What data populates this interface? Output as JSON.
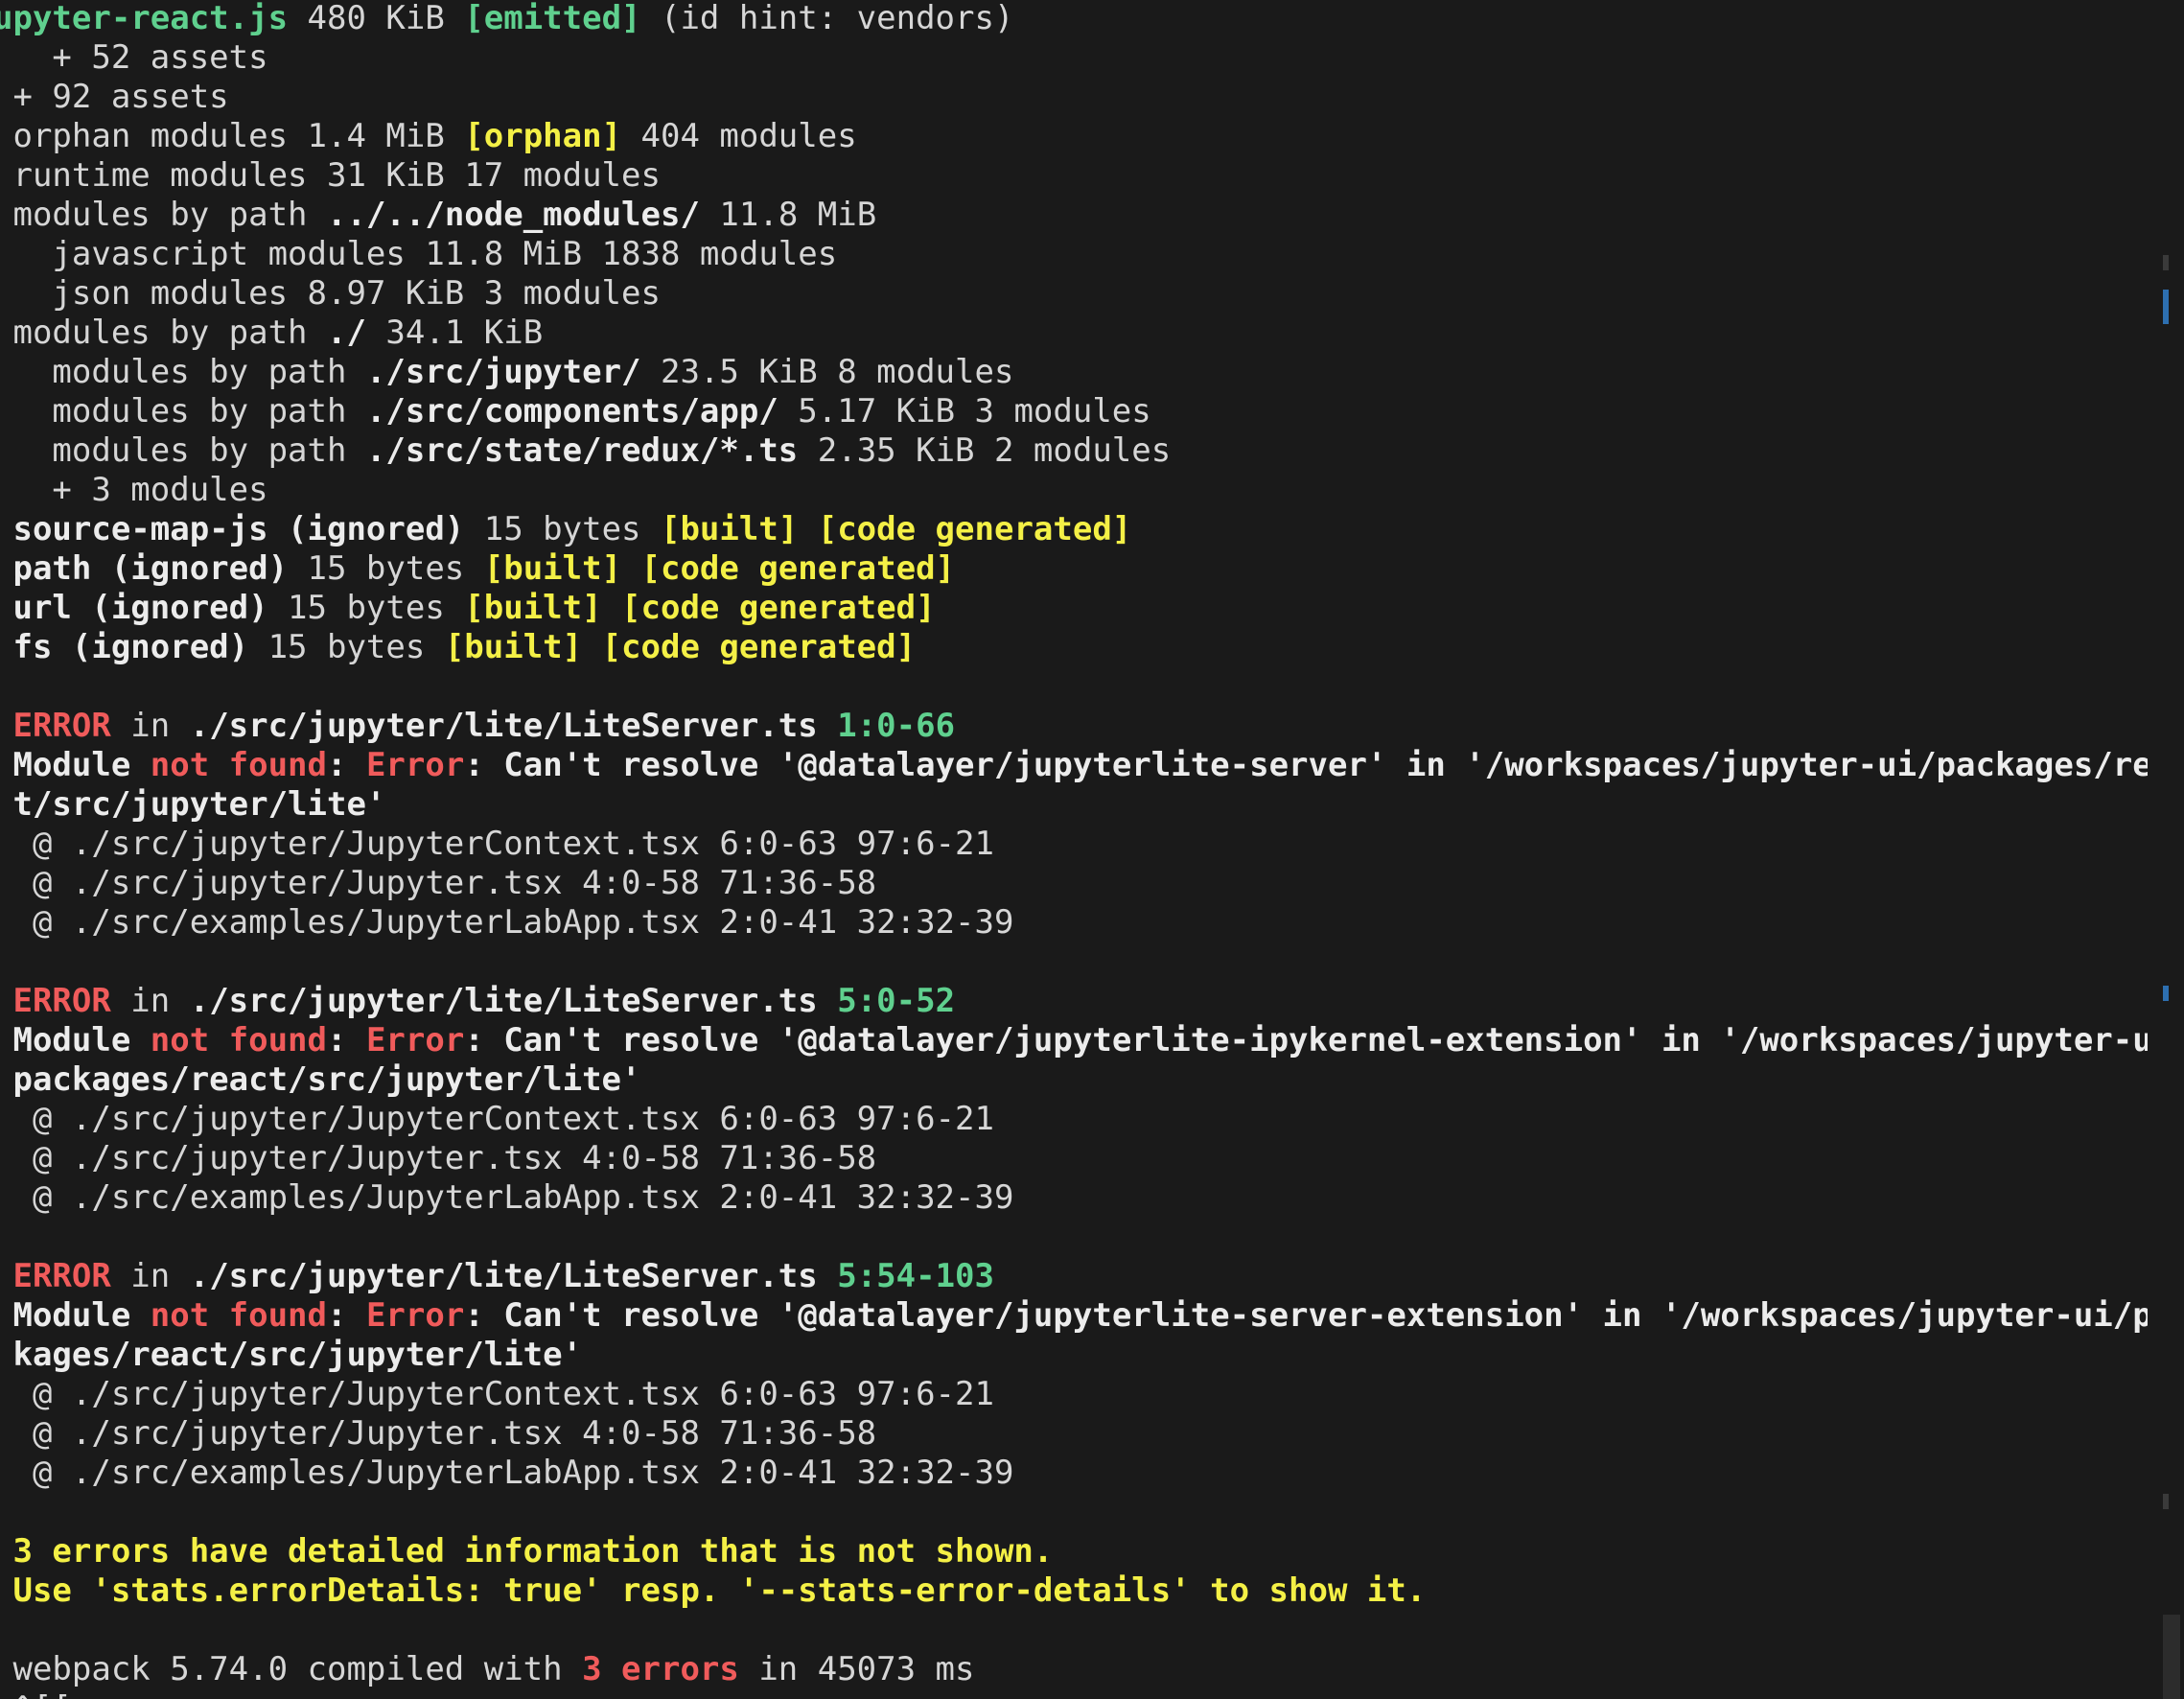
{
  "terminal": {
    "lines": [
      [
        {
          "t": "upyter-react.js ",
          "c": "bgreen"
        },
        {
          "t": "480 KiB ",
          "c": "white"
        },
        {
          "t": "[emitted]",
          "c": "bgreen"
        },
        {
          "t": " (id hint: vendors)",
          "c": "white"
        }
      ],
      [
        {
          "t": "   + 52 assets",
          "c": "white"
        }
      ],
      [
        {
          "t": " + 92 assets",
          "c": "white"
        }
      ],
      [
        {
          "t": " orphan modules 1.4 MiB ",
          "c": "white"
        },
        {
          "t": "[orphan]",
          "c": "yellow"
        },
        {
          "t": " 404 modules",
          "c": "white"
        }
      ],
      [
        {
          "t": " runtime modules 31 KiB 17 modules",
          "c": "white"
        }
      ],
      [
        {
          "t": " modules by path ",
          "c": "white"
        },
        {
          "t": "../../node_modules/",
          "c": "bwhite"
        },
        {
          "t": " 11.8 MiB",
          "c": "white"
        }
      ],
      [
        {
          "t": "   javascript modules 11.8 MiB 1838 modules",
          "c": "white"
        }
      ],
      [
        {
          "t": "   json modules 8.97 KiB 3 modules",
          "c": "white"
        }
      ],
      [
        {
          "t": " modules by path ",
          "c": "white"
        },
        {
          "t": "./",
          "c": "bwhite"
        },
        {
          "t": " 34.1 KiB",
          "c": "white"
        }
      ],
      [
        {
          "t": "   modules by path ",
          "c": "white"
        },
        {
          "t": "./src/jupyter/",
          "c": "bwhite"
        },
        {
          "t": " 23.5 KiB 8 modules",
          "c": "white"
        }
      ],
      [
        {
          "t": "   modules by path ",
          "c": "white"
        },
        {
          "t": "./src/components/app/",
          "c": "bwhite"
        },
        {
          "t": " 5.17 KiB 3 modules",
          "c": "white"
        }
      ],
      [
        {
          "t": "   modules by path ",
          "c": "white"
        },
        {
          "t": "./src/state/redux/*.ts",
          "c": "bwhite"
        },
        {
          "t": " 2.35 KiB 2 modules",
          "c": "white"
        }
      ],
      [
        {
          "t": "   + 3 modules",
          "c": "white"
        }
      ],
      [
        {
          "t": " source-map-js (ignored)",
          "c": "bwhite"
        },
        {
          "t": " 15 bytes ",
          "c": "white"
        },
        {
          "t": "[built] [code generated]",
          "c": "yellow"
        }
      ],
      [
        {
          "t": " path (ignored)",
          "c": "bwhite"
        },
        {
          "t": " 15 bytes ",
          "c": "white"
        },
        {
          "t": "[built] [code generated]",
          "c": "yellow"
        }
      ],
      [
        {
          "t": " url (ignored)",
          "c": "bwhite"
        },
        {
          "t": " 15 bytes ",
          "c": "white"
        },
        {
          "t": "[built] [code generated]",
          "c": "yellow"
        }
      ],
      [
        {
          "t": " fs (ignored)",
          "c": "bwhite"
        },
        {
          "t": " 15 bytes ",
          "c": "white"
        },
        {
          "t": "[built] [code generated]",
          "c": "yellow"
        }
      ],
      [],
      [
        {
          "t": " ERROR",
          "c": "bred"
        },
        {
          "t": " in ",
          "c": "white"
        },
        {
          "t": "./src/jupyter/lite/LiteServer.ts",
          "c": "bwhite"
        },
        {
          "t": " 1:0-66",
          "c": "bgreen"
        }
      ],
      [
        {
          "t": " Module ",
          "c": "bwhite"
        },
        {
          "t": "not found",
          "c": "bred"
        },
        {
          "t": ": ",
          "c": "bwhite"
        },
        {
          "t": "Error",
          "c": "bred"
        },
        {
          "t": ": Can't resolve '@datalayer/jupyterlite-server' in '/workspaces/jupyter-ui/packages/reac",
          "c": "bwhite"
        }
      ],
      [
        {
          "t": " t/src/jupyter/lite'",
          "c": "bwhite"
        }
      ],
      [
        {
          "t": "  @ ./src/jupyter/JupyterContext.tsx 6:0-63 97:6-21",
          "c": "white"
        }
      ],
      [
        {
          "t": "  @ ./src/jupyter/Jupyter.tsx 4:0-58 71:36-58",
          "c": "white"
        }
      ],
      [
        {
          "t": "  @ ./src/examples/JupyterLabApp.tsx 2:0-41 32:32-39",
          "c": "white"
        }
      ],
      [],
      [
        {
          "t": " ERROR",
          "c": "bred"
        },
        {
          "t": " in ",
          "c": "white"
        },
        {
          "t": "./src/jupyter/lite/LiteServer.ts",
          "c": "bwhite"
        },
        {
          "t": " 5:0-52",
          "c": "bgreen"
        }
      ],
      [
        {
          "t": " Module ",
          "c": "bwhite"
        },
        {
          "t": "not found",
          "c": "bred"
        },
        {
          "t": ": ",
          "c": "bwhite"
        },
        {
          "t": "Error",
          "c": "bred"
        },
        {
          "t": ": Can't resolve '@datalayer/jupyterlite-ipykernel-extension' in '/workspaces/jupyter-ui/",
          "c": "bwhite"
        }
      ],
      [
        {
          "t": " packages/react/src/jupyter/lite'",
          "c": "bwhite"
        }
      ],
      [
        {
          "t": "  @ ./src/jupyter/JupyterContext.tsx 6:0-63 97:6-21",
          "c": "white"
        }
      ],
      [
        {
          "t": "  @ ./src/jupyter/Jupyter.tsx 4:0-58 71:36-58",
          "c": "white"
        }
      ],
      [
        {
          "t": "  @ ./src/examples/JupyterLabApp.tsx 2:0-41 32:32-39",
          "c": "white"
        }
      ],
      [],
      [
        {
          "t": " ERROR",
          "c": "bred"
        },
        {
          "t": " in ",
          "c": "white"
        },
        {
          "t": "./src/jupyter/lite/LiteServer.ts",
          "c": "bwhite"
        },
        {
          "t": " 5:54-103",
          "c": "bgreen"
        }
      ],
      [
        {
          "t": " Module ",
          "c": "bwhite"
        },
        {
          "t": "not found",
          "c": "bred"
        },
        {
          "t": ": ",
          "c": "bwhite"
        },
        {
          "t": "Error",
          "c": "bred"
        },
        {
          "t": ": Can't resolve '@datalayer/jupyterlite-server-extension' in '/workspaces/jupyter-ui/pac",
          "c": "bwhite"
        }
      ],
      [
        {
          "t": " kages/react/src/jupyter/lite'",
          "c": "bwhite"
        }
      ],
      [
        {
          "t": "  @ ./src/jupyter/JupyterContext.tsx 6:0-63 97:6-21",
          "c": "white"
        }
      ],
      [
        {
          "t": "  @ ./src/jupyter/Jupyter.tsx 4:0-58 71:36-58",
          "c": "white"
        }
      ],
      [
        {
          "t": "  @ ./src/examples/JupyterLabApp.tsx 2:0-41 32:32-39",
          "c": "white"
        }
      ],
      [],
      [
        {
          "t": " 3 errors have detailed information that is not shown.",
          "c": "yellow"
        }
      ],
      [
        {
          "t": " Use 'stats.errorDetails: true' resp. '--stats-error-details' to show it.",
          "c": "yellow"
        }
      ],
      [],
      [
        {
          "t": " webpack 5.74.0 compiled with ",
          "c": "white"
        },
        {
          "t": "3 errors",
          "c": "bred"
        },
        {
          "t": " in 45073 ms",
          "c": "white"
        }
      ],
      [
        {
          "t": " ^[[",
          "c": "white"
        },
        {
          "t": "",
          "c": "cursor"
        }
      ]
    ]
  },
  "colors": {
    "background": "#1a1a1a",
    "text": "#d6d6d6",
    "green": "#5fd08e",
    "yellow": "#f4f046",
    "red": "#f05b5b",
    "scroll_marker_blue": "#2d6fb0"
  }
}
